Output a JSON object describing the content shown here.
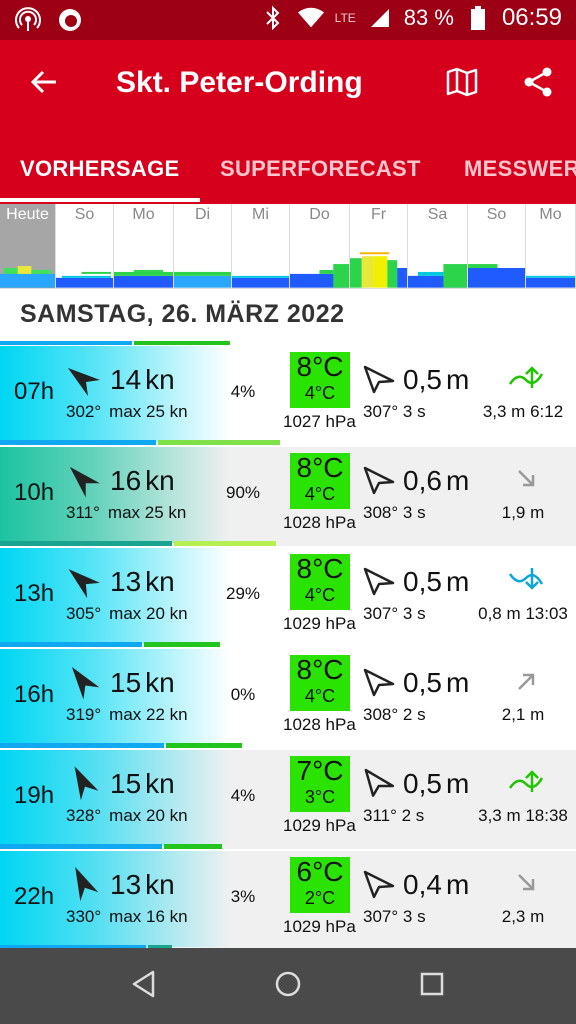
{
  "status": {
    "lte": "LTE",
    "battery": "83 %",
    "time": "06:59"
  },
  "appbar": {
    "title": "Skt. Peter-Ording",
    "tabs": [
      {
        "label": "VORHERSAGE",
        "active": true
      },
      {
        "label": "SUPERFORECAST",
        "active": false
      },
      {
        "label": "MESSWERTE",
        "active": false
      }
    ]
  },
  "days": [
    {
      "label": "Heute",
      "today": true
    },
    {
      "label": "So"
    },
    {
      "label": "Mo"
    },
    {
      "label": "Di"
    },
    {
      "label": "Mi"
    },
    {
      "label": "Do"
    },
    {
      "label": "Fr"
    },
    {
      "label": "Sa"
    },
    {
      "label": "So"
    },
    {
      "label": "Mo"
    }
  ],
  "date_header": "SAMSTAG, 26. MÄRZ 2022",
  "rows": [
    {
      "hour": "07h",
      "wind_kn": "14",
      "wind_unit": "kn",
      "dir": "302°",
      "max": "max 25 kn",
      "rain": "4%",
      "temp": "8°C",
      "temp2": "4°C",
      "pressure": "1027 hPa",
      "wave": "0,5",
      "wave_unit": "m",
      "wave_sub": "307° 3 s",
      "tide": "3,3 m 6:12",
      "tide_type": "up",
      "bg": "#00d6f2"
    },
    {
      "hour": "10h",
      "wind_kn": "16",
      "wind_unit": "kn",
      "dir": "311°",
      "max": "max 25 kn",
      "rain": "90%",
      "temp": "8°C",
      "temp2": "4°C",
      "pressure": "1028 hPa",
      "wave": "0,6",
      "wave_unit": "m",
      "wave_sub": "308° 3 s",
      "tide": "1,9 m",
      "tide_type": "down-small",
      "bg": "#1cc3a0"
    },
    {
      "hour": "13h",
      "wind_kn": "13",
      "wind_unit": "kn",
      "dir": "305°",
      "max": "max 20 kn",
      "rain": "29%",
      "temp": "8°C",
      "temp2": "4°C",
      "pressure": "1029 hPa",
      "wave": "0,5",
      "wave_unit": "m",
      "wave_sub": "307° 3 s",
      "tide": "0,8 m 13:03",
      "tide_type": "down",
      "bg": "#00d6f2"
    },
    {
      "hour": "16h",
      "wind_kn": "15",
      "wind_unit": "kn",
      "dir": "319°",
      "max": "max 22 kn",
      "rain": "0%",
      "temp": "8°C",
      "temp2": "4°C",
      "pressure": "1028 hPa",
      "wave": "0,5",
      "wave_unit": "m",
      "wave_sub": "308° 2 s",
      "tide": "2,1 m",
      "tide_type": "up-small",
      "bg": "#00d6f2"
    },
    {
      "hour": "19h",
      "wind_kn": "15",
      "wind_unit": "kn",
      "dir": "328°",
      "max": "max 20 kn",
      "rain": "4%",
      "temp": "7°C",
      "temp2": "3°C",
      "pressure": "1029 hPa",
      "wave": "0,5",
      "wave_unit": "m",
      "wave_sub": "311° 2 s",
      "tide": "3,3 m 18:38",
      "tide_type": "up",
      "bg": "#00d6f2"
    },
    {
      "hour": "22h",
      "wind_kn": "13",
      "wind_unit": "kn",
      "dir": "330°",
      "max": "max 16 kn",
      "rain": "3%",
      "temp": "6°C",
      "temp2": "2°C",
      "pressure": "1029 hPa",
      "wave": "0,4",
      "wave_unit": "m",
      "wave_sub": "307° 3 s",
      "tide": "2,3 m",
      "tide_type": "down-small",
      "bg": "#00d6f2"
    }
  ],
  "colors": {
    "statusbar": "#9d0015",
    "appbar": "#d6001c",
    "temp_box": "#2ae302",
    "tide_up": "#1ec500",
    "tide_down": "#0aa6d8"
  },
  "icons": {
    "back": "arrow-left-icon",
    "map": "map-icon",
    "share": "share-icon",
    "nav_back": "triangle-back-icon",
    "nav_home": "circle-home-icon",
    "nav_recent": "square-recent-icon"
  }
}
